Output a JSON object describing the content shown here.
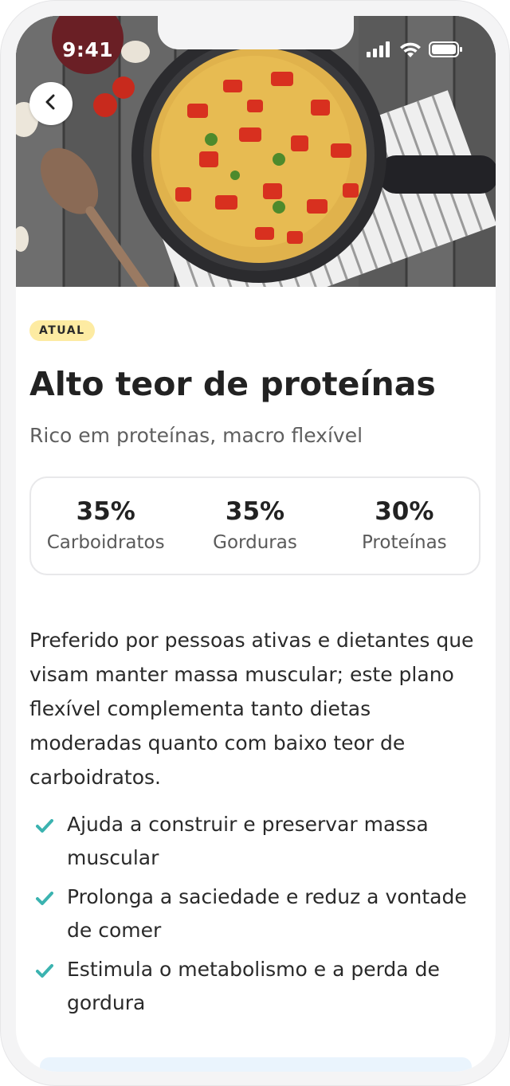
{
  "status_bar": {
    "time": "9:41"
  },
  "hero": {
    "image_alt": "Omelete com tomates em frigideira"
  },
  "badge": "ATUAL",
  "plan": {
    "title": "Alto teor de proteínas",
    "subtitle": "Rico em proteínas, macro flexível"
  },
  "macros": [
    {
      "value": "35%",
      "label": "Carboidratos"
    },
    {
      "value": "35%",
      "label": "Gorduras"
    },
    {
      "value": "30%",
      "label": "Proteínas"
    }
  ],
  "description": "Preferido por pessoas ativas e dietantes que visam manter massa muscular; este plano flexível complementa tanto dietas moderadas quanto com baixo teor de carboidratos.",
  "benefits": [
    "Ajuda a construir e preservar massa muscular",
    "Prolonga a saciedade e reduz a vontade de comer",
    "Estimula o metabolismo e a perda de gordura"
  ],
  "colors": {
    "accent_check": "#3bb3b0",
    "badge_bg": "#fdeba2",
    "text_primary": "#222222"
  }
}
